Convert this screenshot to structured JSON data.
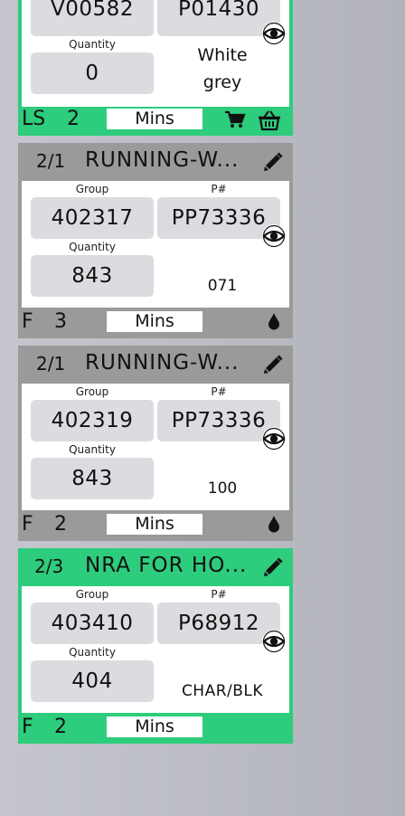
{
  "cards": [
    {
      "group_value": "V00582",
      "pnum_value": "P01430",
      "quantity_label": "Quantity",
      "quantity_value": "0",
      "color_line1": "White",
      "color_line2": "grey",
      "footer_code": "LS",
      "footer_count": "2",
      "mins_label": "Mins",
      "status_color": "#2ecc7d",
      "footer_icons": [
        "cart-icon",
        "basket-icon"
      ]
    },
    {
      "header_num": "2/1",
      "header_title": "RUNNING-W...",
      "group_label": "Group",
      "group_value": "402317",
      "pnum_label": "P#",
      "pnum_value": "PP73336",
      "quantity_label": "Quantity",
      "quantity_value": "843",
      "color_text": "071",
      "footer_code": "F",
      "footer_count": "3",
      "mins_label": "Mins",
      "status_color": "#9a9a9a",
      "footer_icons": [
        "drop-icon"
      ]
    },
    {
      "header_num": "2/1",
      "header_title": "RUNNING-W...",
      "group_label": "Group",
      "group_value": "402319",
      "pnum_label": "P#",
      "pnum_value": "PP73336",
      "quantity_label": "Quantity",
      "quantity_value": "843",
      "color_text": "100",
      "footer_code": "F",
      "footer_count": "2",
      "mins_label": "Mins",
      "status_color": "#9a9a9a",
      "footer_icons": [
        "drop-icon"
      ]
    },
    {
      "header_num": "2/3",
      "header_title": "NRA FOR HO...",
      "group_label": "Group",
      "group_value": "403410",
      "pnum_label": "P#",
      "pnum_value": "P68912",
      "quantity_label": "Quantity",
      "quantity_value": "404",
      "color_text": "CHAR/BLK",
      "footer_code": "F",
      "footer_count": "2",
      "mins_label": "Mins",
      "status_color": "#2ecc7d",
      "footer_icons": []
    }
  ]
}
